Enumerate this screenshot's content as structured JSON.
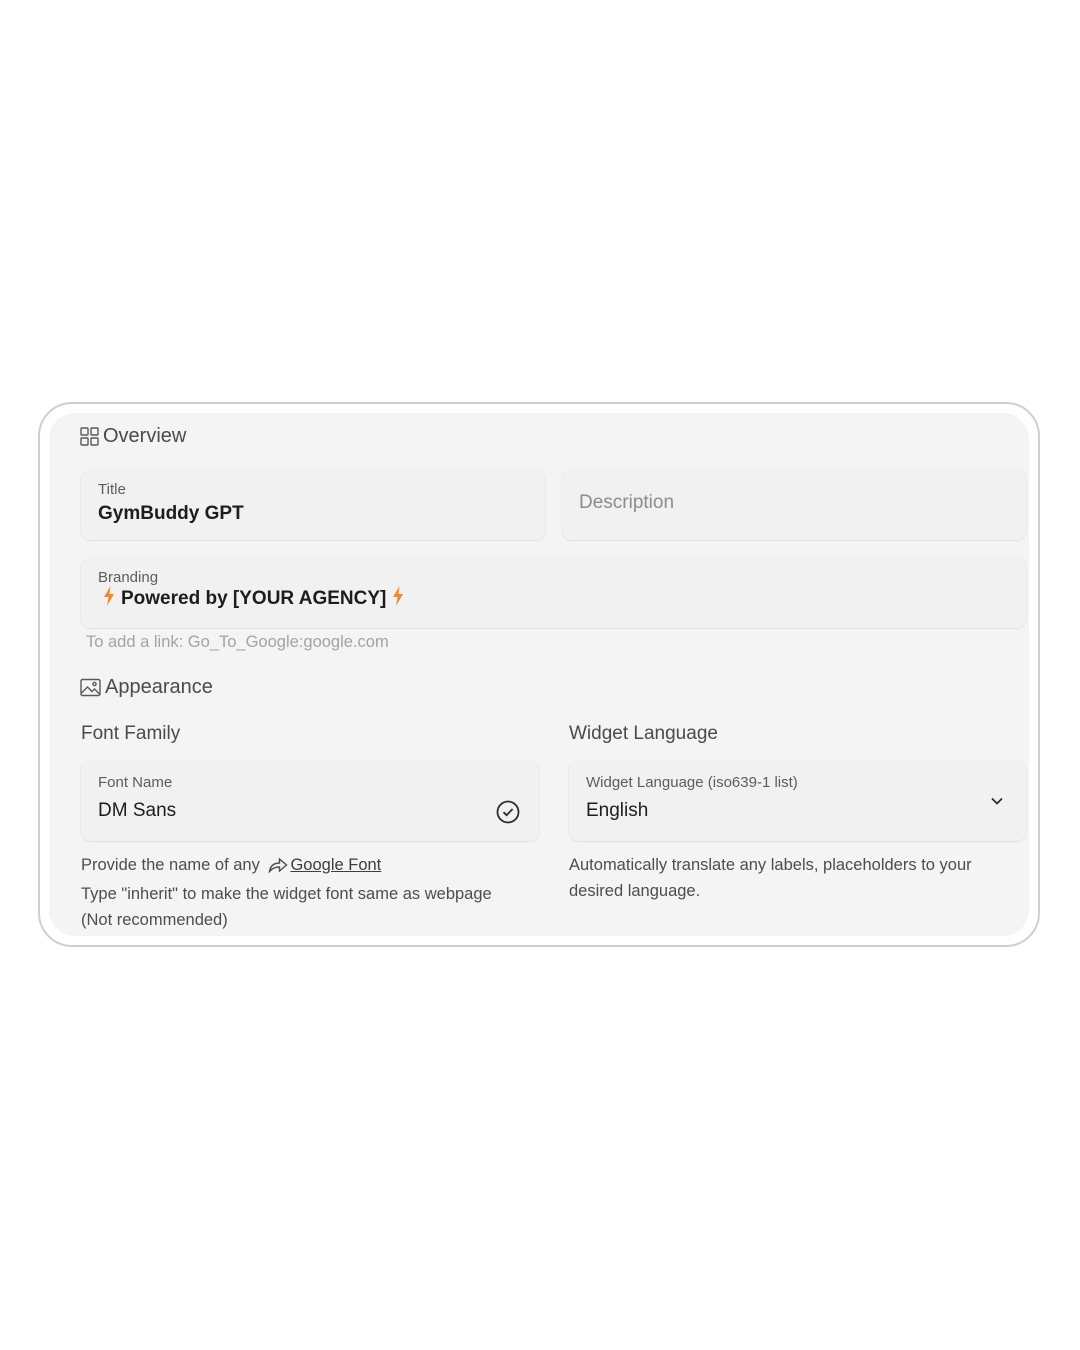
{
  "overview": {
    "heading": "Overview",
    "icon": "grid-icon",
    "title_label": "Title",
    "title_value": "GymBuddy GPT",
    "description_placeholder": "Description",
    "branding_label": "Branding",
    "branding_value": "Powered by [YOUR AGENCY]",
    "branding_icon": "lightning-bolt-icon",
    "branding_hint": "To add a link: Go_To_Google:google.com"
  },
  "appearance": {
    "heading": "Appearance",
    "icon": "image-icon",
    "font_family": {
      "title": "Font Family",
      "field_label": "Font Name",
      "field_value": "DM Sans",
      "status_icon": "check-circle-icon",
      "help_prefix": "Provide the name of any",
      "help_link": "Google Font",
      "help_line2": "Type \"inherit\" to make the widget font same as webpage",
      "help_line3": "(Not recommended)"
    },
    "widget_language": {
      "title": "Widget Language",
      "field_label": "Widget Language (iso639-1 list)",
      "field_value": "English",
      "dropdown_icon": "chevron-down-icon",
      "help_line1": "Automatically translate any labels, placeholders to your",
      "help_line2": "desired language."
    }
  },
  "colors": {
    "accent": "#f08a2a",
    "panel_bg": "#f4f4f4",
    "field_bg": "#f1f1f1",
    "frame_border": "#cfcfcf"
  }
}
